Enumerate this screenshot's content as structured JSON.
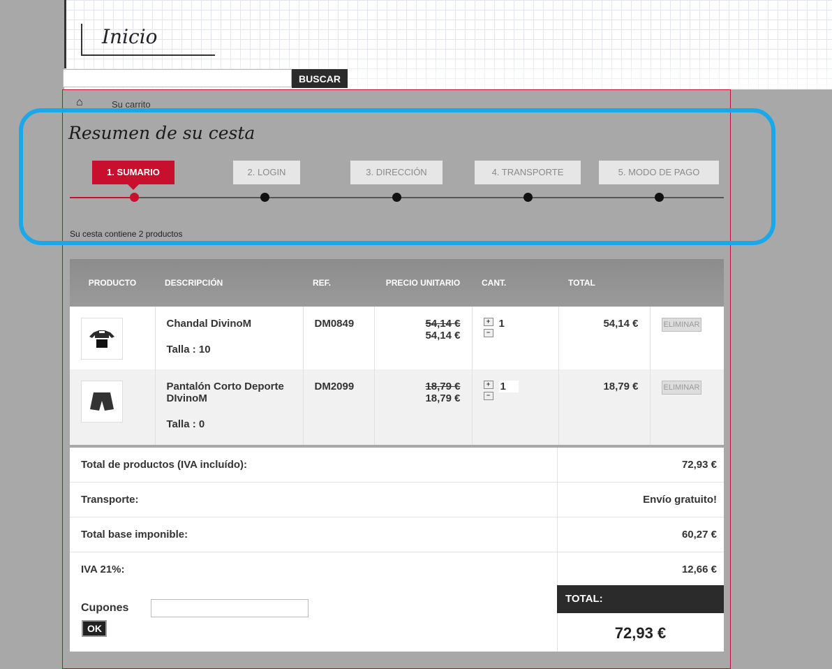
{
  "header": {
    "title": "Inicio"
  },
  "search": {
    "placeholder": "",
    "button_label": "BUSCAR"
  },
  "breadcrumb": {
    "text": "Su carrito"
  },
  "page": {
    "title": "Resumen de su cesta",
    "cart_summary": "Su cesta contiene 2 productos"
  },
  "steps": [
    {
      "label": "1. SUMARIO",
      "active": true
    },
    {
      "label": "2. LOGIN",
      "active": false
    },
    {
      "label": "3. DIRECCIÓN",
      "active": false
    },
    {
      "label": "4. TRANSPORTE",
      "active": false
    },
    {
      "label": "5. MODO DE PAGO",
      "active": false
    }
  ],
  "table": {
    "headers": [
      "PRODUCTO",
      "DESCRIPCIÓN",
      "REF.",
      "PRECIO UNITARIO",
      "CANT.",
      "TOTAL"
    ],
    "rows": [
      {
        "thumb_icon": "tracksuit-icon",
        "name": "Chandal DivinoM",
        "size": "Talla : 10",
        "ref": "DM0849",
        "price_old": "54,14 €",
        "price_new": "54,14 €",
        "qty": "1",
        "total": "54,14 €",
        "delete_label": "ELIMINAR"
      },
      {
        "thumb_icon": "shorts-icon",
        "name": "Pantalón Corto Deporte DIvinoM",
        "size": "Talla : 0",
        "ref": "DM2099",
        "price_old": "18,79 €",
        "price_new": "18,79 €",
        "qty": "1",
        "total": "18,79 €",
        "delete_label": "ELIMINAR"
      }
    ]
  },
  "totals": [
    {
      "label": "Total de productos (IVA incluído):",
      "value": "72,93 €"
    },
    {
      "label": "Transporte:",
      "value": "Envío gratuito!"
    },
    {
      "label": "Total base imponible:",
      "value": "60,27 €"
    },
    {
      "label": "IVA 21%:",
      "value": "12,66 €"
    }
  ],
  "coupon": {
    "label": "Cupones",
    "button_label": "OK",
    "value": ""
  },
  "grand_total": {
    "label": "TOTAL:",
    "value": "72,93 €"
  },
  "colors": {
    "accent": "#c8102e",
    "highlight": "#1aa8ea",
    "background": "#a8a8a8"
  }
}
